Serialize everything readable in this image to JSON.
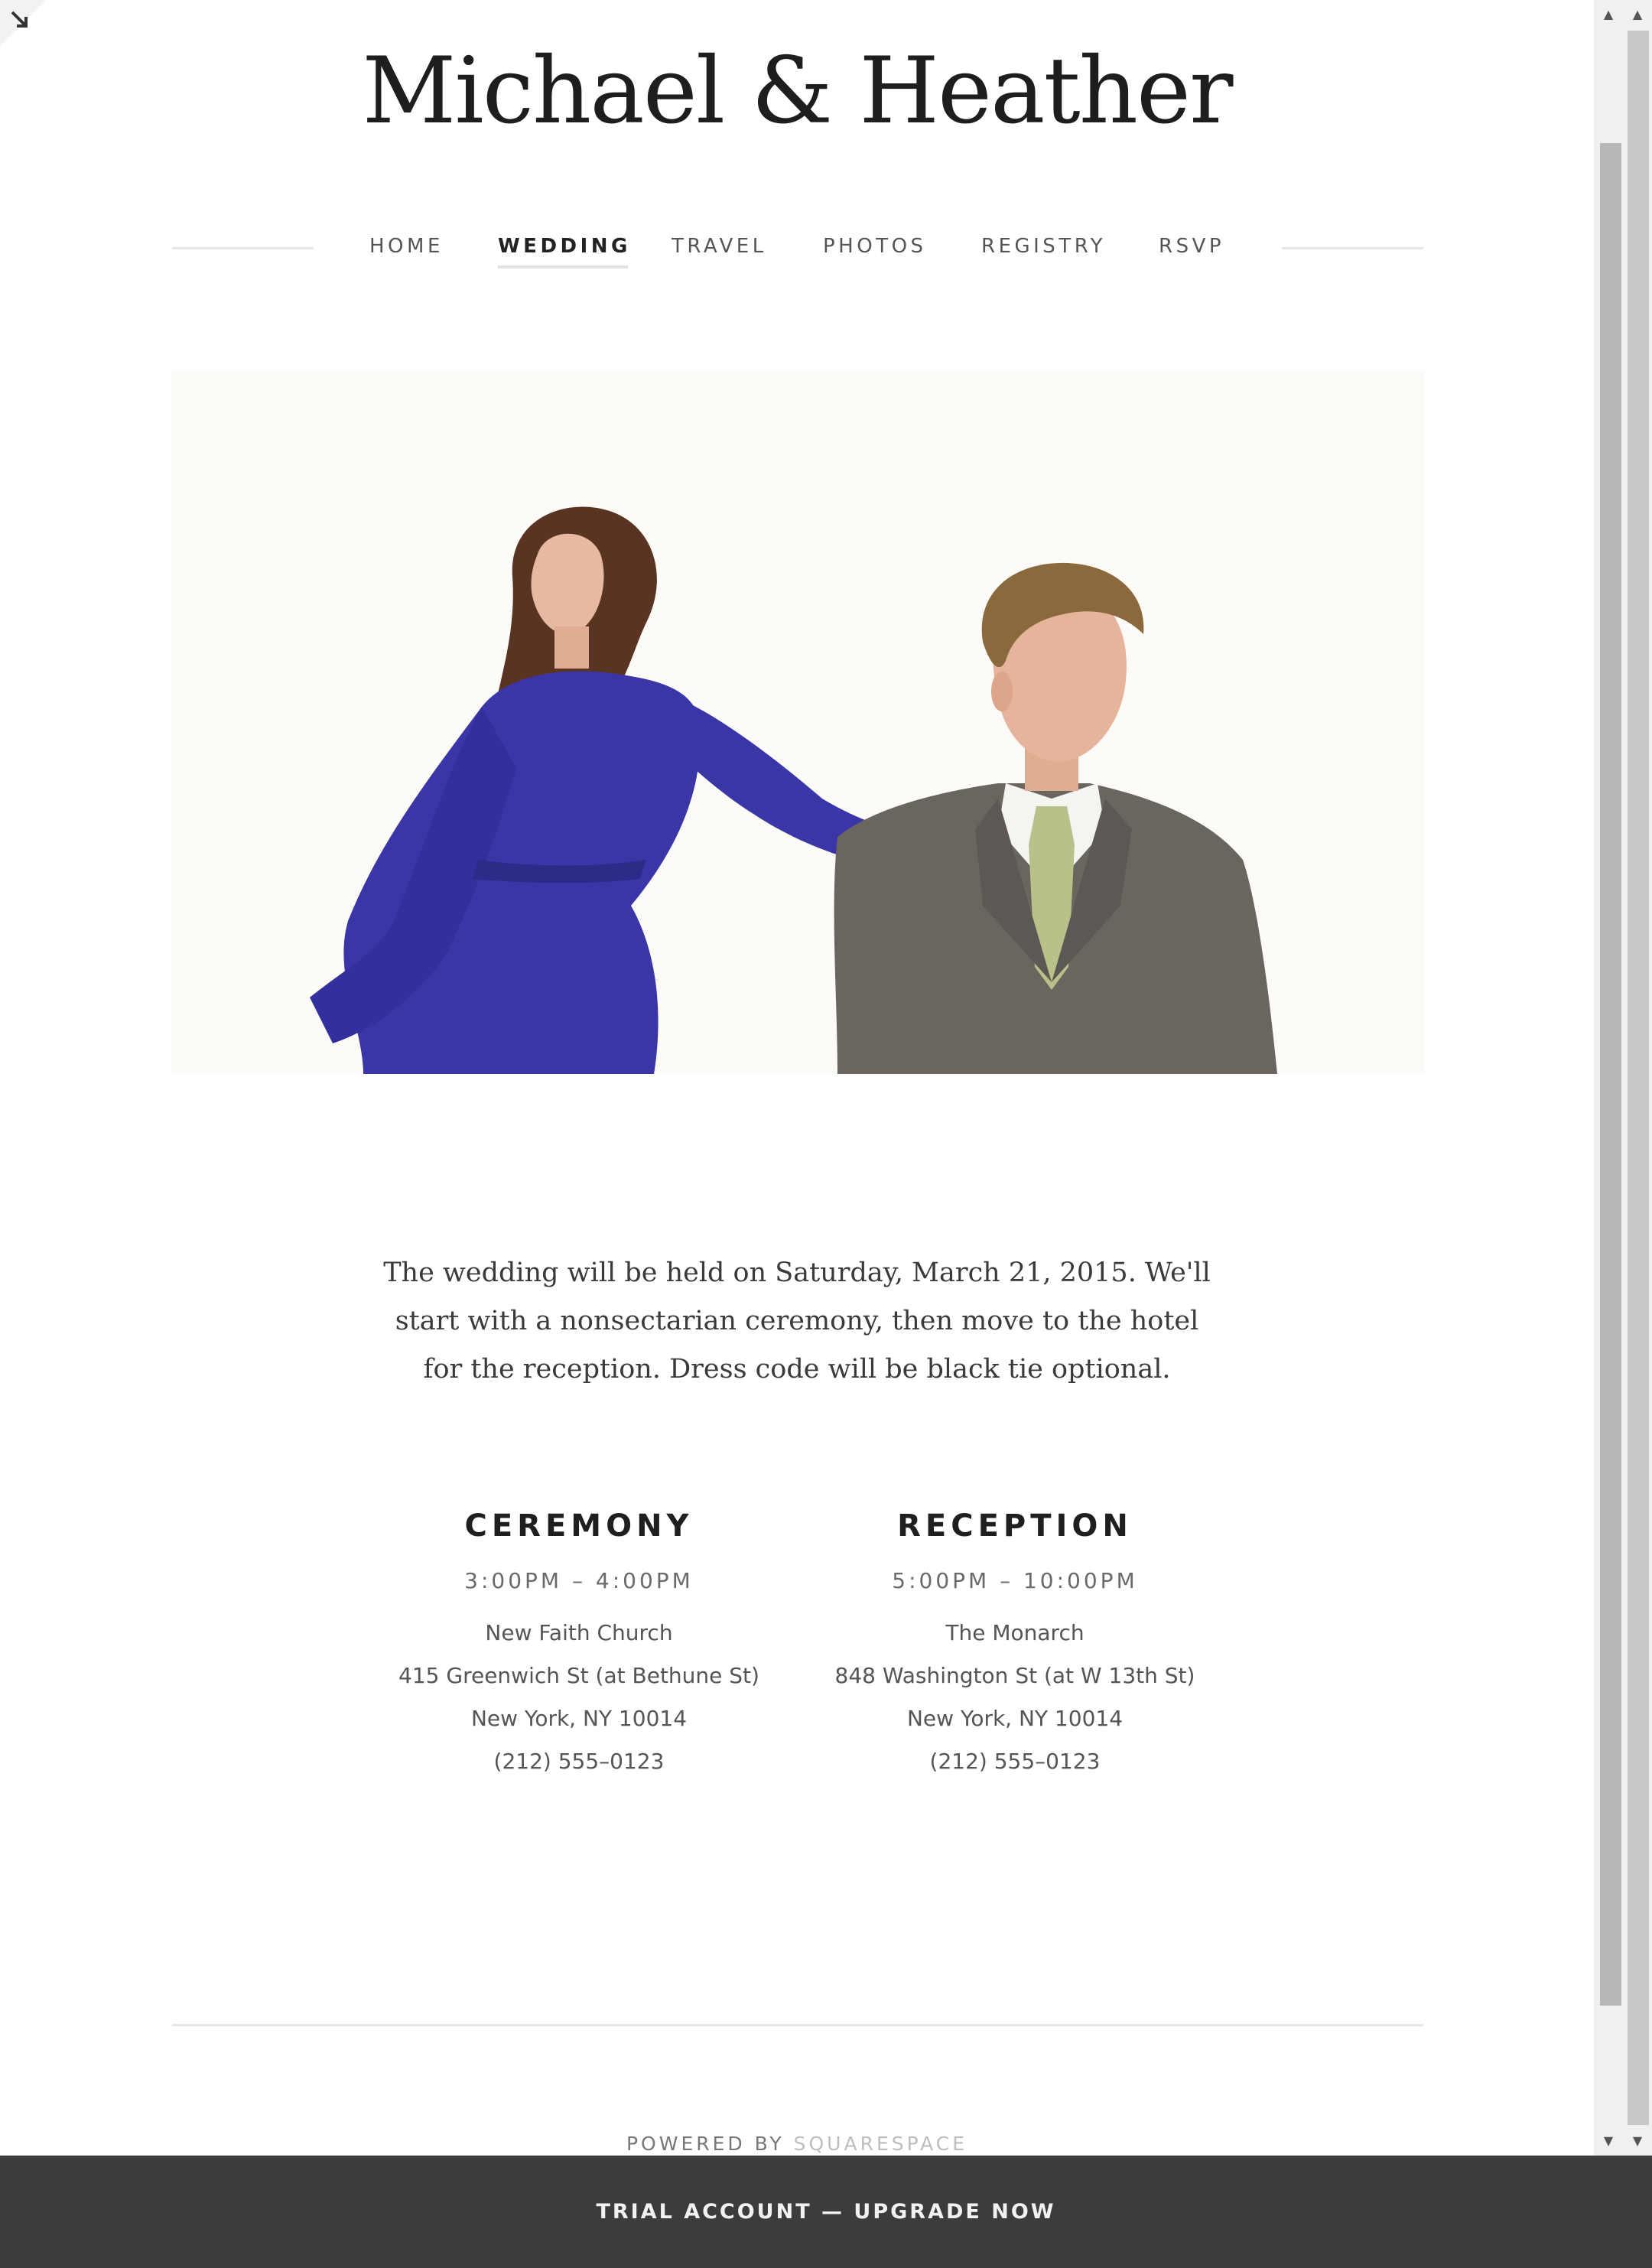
{
  "site": {
    "title": "Michael & Heather"
  },
  "nav": {
    "items": [
      {
        "label": "HOME",
        "active": false
      },
      {
        "label": "WEDDING",
        "active": true
      },
      {
        "label": "TRAVEL",
        "active": false
      },
      {
        "label": "PHOTOS",
        "active": false
      },
      {
        "label": "REGISTRY",
        "active": false
      },
      {
        "label": "RSVP",
        "active": false
      }
    ]
  },
  "intro": {
    "text": "The wedding will be held on Saturday, March 21, 2015. We'll start with a nonsectarian ceremony, then move to the hotel for the reception. Dress code will be black tie optional."
  },
  "events": [
    {
      "title": "CEREMONY",
      "time": "3:00PM – 4:00PM",
      "venue": "New Faith Church",
      "address": "415 Greenwich St (at Bethune St)",
      "city": "New York, NY 10014",
      "phone": "(212) 555–0123"
    },
    {
      "title": "RECEPTION",
      "time": "5:00PM – 10:00PM",
      "venue": "The Monarch",
      "address": "848 Washington St (at W 13th St)",
      "city": "New York, NY 10014",
      "phone": "(212) 555–0123"
    }
  ],
  "footer": {
    "powered_by": "POWERED BY",
    "brand": "SQUARESPACE"
  },
  "trial_bar": {
    "label": "TRIAL ACCOUNT — UPGRADE NOW"
  },
  "colors": {
    "dress": "#3b36a8",
    "suit": "#6b6560",
    "tie": "#b9c08a",
    "hair_woman": "#5a3422",
    "hair_man": "#8a6a3c",
    "skin": "#e3b49a",
    "trial_bar": "#3c3c3c"
  }
}
